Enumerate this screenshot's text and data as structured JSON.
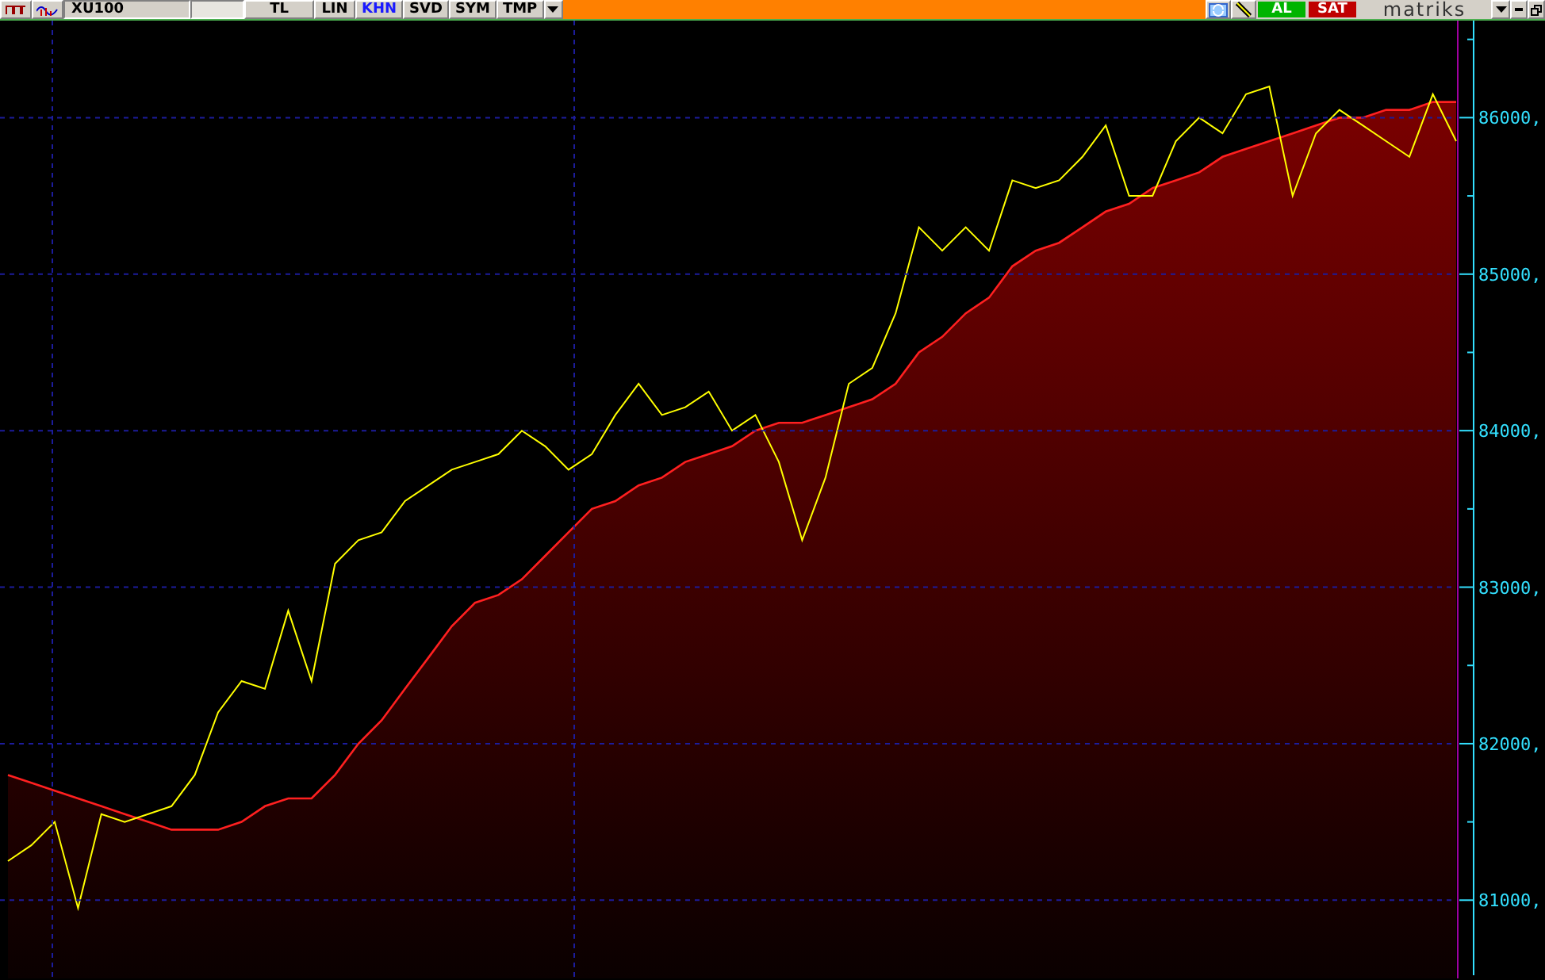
{
  "toolbar": {
    "symbol": "XU100",
    "modes": [
      {
        "label": "TL",
        "selected": false
      },
      {
        "label": "LIN",
        "selected": false
      },
      {
        "label": "KHN",
        "selected": true
      },
      {
        "label": "SVD",
        "selected": false
      },
      {
        "label": "SYM",
        "selected": false
      },
      {
        "label": "TMP",
        "selected": false
      }
    ],
    "buy": "AL",
    "sell": "SAT",
    "logo": "matriks"
  },
  "chart": {
    "chart_data": {
      "type": "line",
      "grid": true,
      "categories": [
        null,
        null,
        null,
        null,
        null,
        null,
        null,
        null,
        null,
        null,
        null,
        null,
        null,
        null,
        null,
        null,
        null,
        null,
        null,
        null,
        null,
        null,
        null,
        null,
        null,
        null,
        null,
        null,
        null,
        null,
        null,
        null,
        null,
        null,
        null,
        null,
        null,
        null,
        null,
        null,
        null,
        null,
        null,
        null,
        null,
        null,
        null,
        null,
        null,
        null,
        null,
        null,
        null,
        null,
        null,
        null,
        null,
        null,
        null,
        null,
        null,
        null,
        null
      ],
      "ylim": [
        80500,
        86620
      ],
      "yticks": [
        {
          "value": 81000,
          "label": "81000,"
        },
        {
          "value": 82000,
          "label": "82000,"
        },
        {
          "value": 83000,
          "label": "83000,"
        },
        {
          "value": 84000,
          "label": "84000,"
        },
        {
          "value": 85000,
          "label": "85000,"
        },
        {
          "value": 86000,
          "label": "86000,"
        }
      ],
      "series": [
        {
          "type": "line",
          "color": "#ffff00",
          "values": [
            81250,
            81350,
            81500,
            80950,
            81550,
            81500,
            81550,
            81600,
            81800,
            82200,
            82400,
            82350,
            82850,
            82400,
            83150,
            83300,
            83350,
            83550,
            83650,
            83750,
            83800,
            83850,
            84000,
            83900,
            83750,
            83850,
            84100,
            84300,
            84100,
            84150,
            84250,
            84000,
            84100,
            83800,
            83300,
            83700,
            84300,
            84400,
            84750,
            85300,
            85150,
            85300,
            85150,
            85600,
            85550,
            85600,
            85750,
            85950,
            85500,
            85500,
            85850,
            86000,
            85900,
            86150,
            86200,
            85500,
            85900,
            86050,
            85950,
            85850,
            85750,
            86150,
            85850
          ]
        },
        {
          "type": "area",
          "color": "#ff2020",
          "values": [
            81800,
            81750,
            81700,
            81650,
            81600,
            81550,
            81500,
            81450,
            81450,
            81450,
            81500,
            81600,
            81650,
            81650,
            81800,
            82000,
            82150,
            82350,
            82550,
            82750,
            82900,
            82950,
            83050,
            83200,
            83350,
            83500,
            83550,
            83650,
            83700,
            83800,
            83850,
            83900,
            84000,
            84050,
            84050,
            84100,
            84150,
            84200,
            84300,
            84500,
            84600,
            84750,
            84850,
            85050,
            85150,
            85200,
            85300,
            85400,
            85450,
            85550,
            85600,
            85650,
            85750,
            85800,
            85850,
            85900,
            85950,
            86000,
            86000,
            86050,
            86050,
            86100,
            86100
          ]
        }
      ]
    }
  }
}
